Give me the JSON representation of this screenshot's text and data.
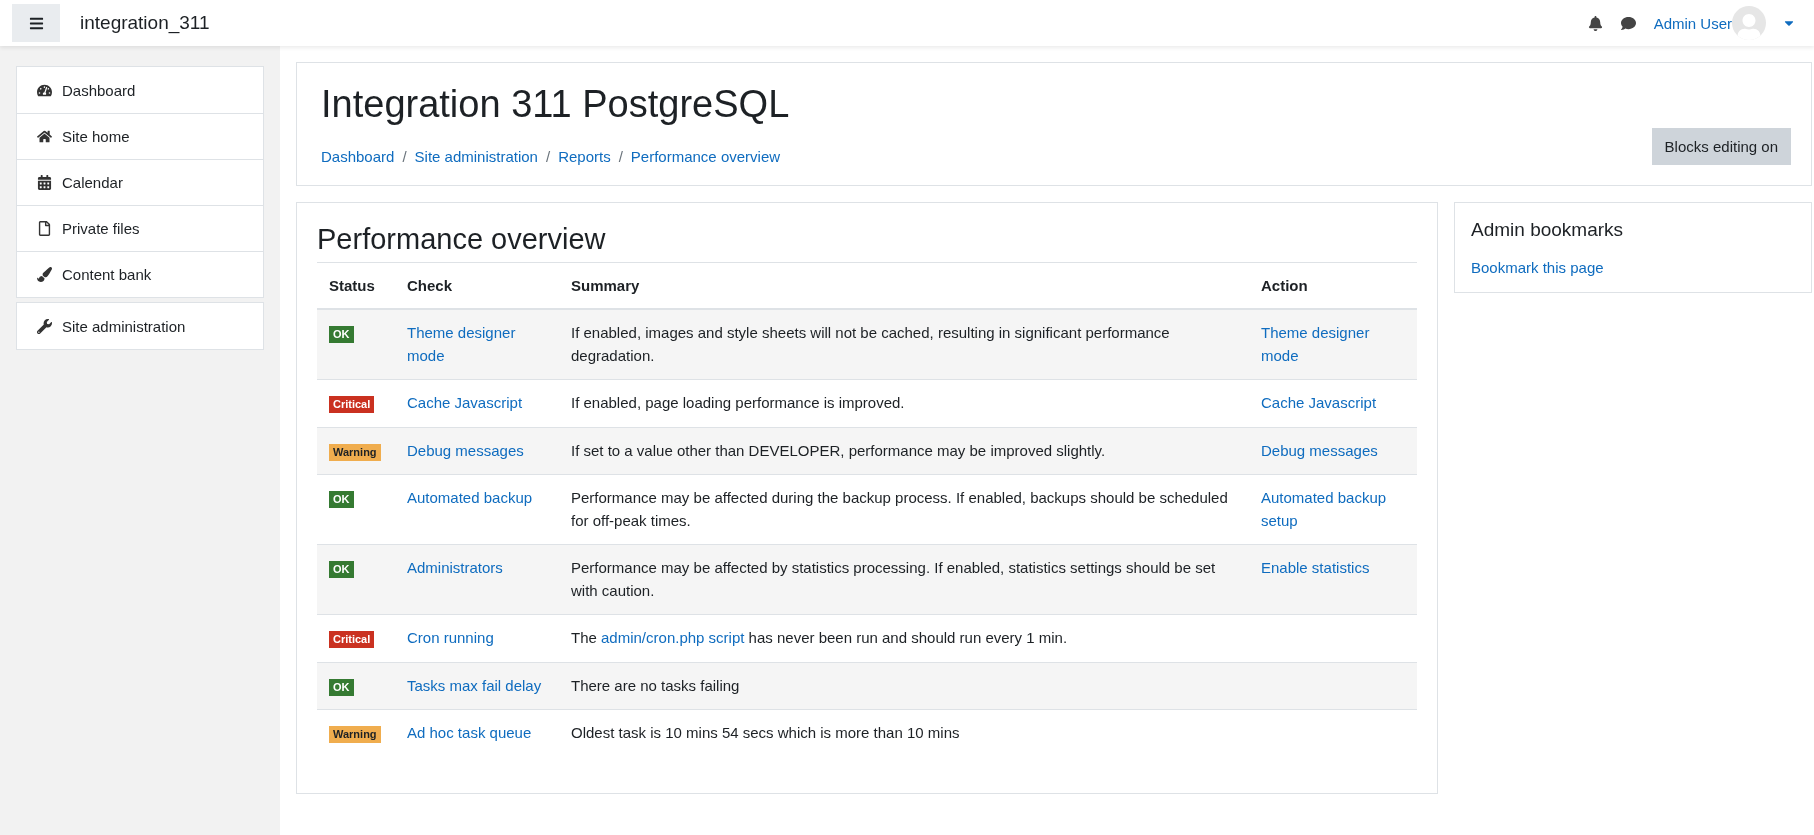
{
  "navbar": {
    "site_name": "integration_311",
    "user_name": "Admin User"
  },
  "sidebar": {
    "items": [
      {
        "label": "Dashboard"
      },
      {
        "label": "Site home"
      },
      {
        "label": "Calendar"
      },
      {
        "label": "Private files"
      },
      {
        "label": "Content bank"
      }
    ],
    "admin_item": {
      "label": "Site administration"
    }
  },
  "header": {
    "title": "Integration 311 PostgreSQL",
    "breadcrumbs": [
      "Dashboard",
      "Site administration",
      "Reports",
      "Performance overview"
    ],
    "breadcrumb_separator": "/",
    "button": "Blocks editing on"
  },
  "main": {
    "heading": "Performance overview",
    "table": {
      "columns": [
        "Status",
        "Check",
        "Summary",
        "Action"
      ],
      "rows": [
        {
          "status": {
            "label": "OK",
            "kind": "ok"
          },
          "check": "Theme designer mode",
          "summary": [
            {
              "kind": "text",
              "text": "If enabled, images and style sheets will not be cached, resulting in significant performance degradation."
            }
          ],
          "action": "Theme designer mode"
        },
        {
          "status": {
            "label": "Critical",
            "kind": "critical"
          },
          "check": "Cache Javascript",
          "summary": [
            {
              "kind": "text",
              "text": "If enabled, page loading performance is improved."
            }
          ],
          "action": "Cache Javascript"
        },
        {
          "status": {
            "label": "Warning",
            "kind": "warning"
          },
          "check": "Debug messages",
          "summary": [
            {
              "kind": "text",
              "text": "If set to a value other than DEVELOPER, performance may be improved slightly."
            }
          ],
          "action": "Debug messages"
        },
        {
          "status": {
            "label": "OK",
            "kind": "ok"
          },
          "check": "Automated backup",
          "summary": [
            {
              "kind": "text",
              "text": "Performance may be affected during the backup process. If enabled, backups should be scheduled for off-peak times."
            }
          ],
          "action": "Automated backup setup"
        },
        {
          "status": {
            "label": "OK",
            "kind": "ok"
          },
          "check": "Administrators",
          "summary": [
            {
              "kind": "text",
              "text": "Performance may be affected by statistics processing. If enabled, statistics settings should be set with caution."
            }
          ],
          "action": "Enable statistics"
        },
        {
          "status": {
            "label": "Critical",
            "kind": "critical"
          },
          "check": "Cron running",
          "summary": [
            {
              "kind": "text",
              "text": "The "
            },
            {
              "kind": "link",
              "text": "admin/cron.php script"
            },
            {
              "kind": "text",
              "text": " has never been run and should run every 1 min."
            }
          ]
        },
        {
          "status": {
            "label": "OK",
            "kind": "ok"
          },
          "check": "Tasks max fail delay",
          "summary": [
            {
              "kind": "text",
              "text": "There are no tasks failing"
            }
          ]
        },
        {
          "status": {
            "label": "Warning",
            "kind": "warning"
          },
          "check": "Ad hoc task queue",
          "summary": [
            {
              "kind": "text",
              "text": "Oldest task is 10 mins 54 secs which is more than 10 mins"
            }
          ]
        }
      ]
    }
  },
  "block": {
    "title": "Admin bookmarks",
    "link": "Bookmark this page"
  }
}
